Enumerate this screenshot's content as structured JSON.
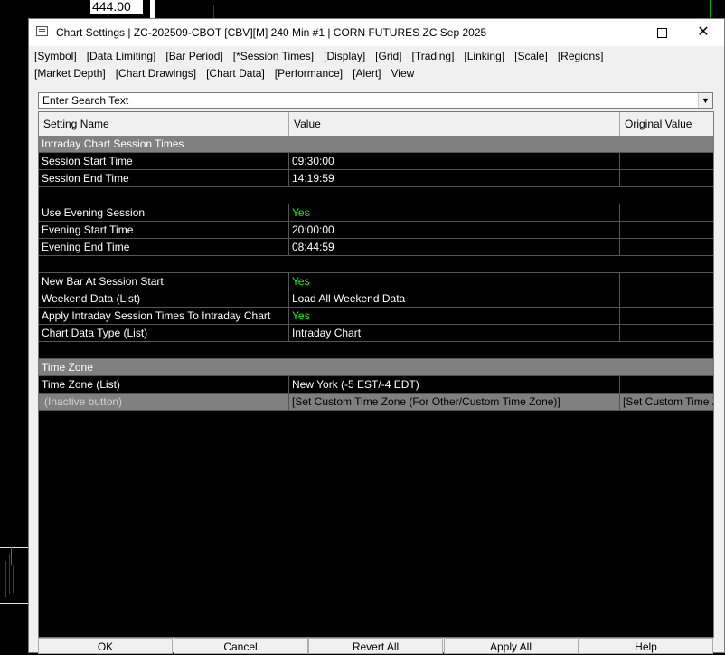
{
  "background": {
    "price_label": "444.00"
  },
  "window": {
    "title": "Chart Settings | ZC-202509-CBOT [CBV][M]  240 Min  #1 | CORN FUTURES ZC Sep 2025",
    "controls": {
      "minimize": "minimize-icon",
      "maximize": "maximize-icon",
      "close": "close-icon"
    }
  },
  "menu": [
    "[Symbol]",
    "[Data Limiting]",
    "[Bar Period]",
    "[*Session Times]",
    "[Display]",
    "[Grid]",
    "[Trading]",
    "[Linking]",
    "[Scale]",
    "[Regions]",
    "[Market Depth]",
    "[Chart Drawings]",
    "[Chart Data]",
    "[Performance]",
    "[Alert]",
    "View"
  ],
  "search": {
    "placeholder": "Enter Search Text"
  },
  "grid": {
    "headers": [
      "Setting Name",
      "Value",
      "Original Value"
    ],
    "rows": [
      {
        "type": "section",
        "name": "Intraday Chart Session Times"
      },
      {
        "type": "row",
        "name": "Session Start Time",
        "value": "09:30:00"
      },
      {
        "type": "row",
        "name": "Session End Time",
        "value": "14:19:59"
      },
      {
        "type": "empty"
      },
      {
        "type": "row",
        "name": "Use Evening Session",
        "value": "Yes",
        "green": true
      },
      {
        "type": "row",
        "name": "Evening Start Time",
        "value": "20:00:00"
      },
      {
        "type": "row",
        "name": "Evening End Time",
        "value": "08:44:59"
      },
      {
        "type": "empty"
      },
      {
        "type": "row",
        "name": "New Bar At Session Start",
        "value": "Yes",
        "green": true
      },
      {
        "type": "row",
        "name": "Weekend Data (List)",
        "value": "Load All Weekend Data"
      },
      {
        "type": "row",
        "name": "Apply Intraday Session Times To Intraday Chart",
        "value": "Yes",
        "green": true
      },
      {
        "type": "row",
        "name": "Chart Data Type (List)",
        "value": "Intraday Chart"
      },
      {
        "type": "empty"
      },
      {
        "type": "section",
        "name": "Time Zone"
      },
      {
        "type": "row",
        "name": "Time Zone (List)",
        "value": "New York (-5 EST/-4 EDT)"
      },
      {
        "type": "inactive",
        "name": "(Inactive button)",
        "value": "[Set Custom Time Zone (For Other/Custom Time Zone)]",
        "original": "[Set Custom Time Zone (For Other/Custom Time Zone)]"
      }
    ]
  },
  "buttons": [
    "OK",
    "Cancel",
    "Revert All",
    "Apply All",
    "Help"
  ]
}
